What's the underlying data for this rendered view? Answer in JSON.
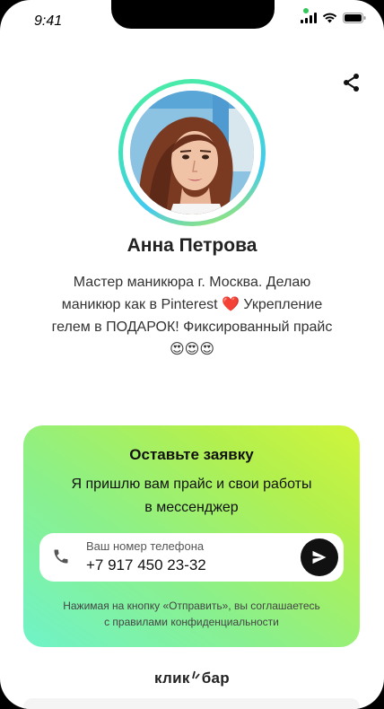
{
  "status_bar": {
    "time": "9:41"
  },
  "profile": {
    "name": "Анна Петрова",
    "bio_line1": "Мастер маникюра г. Москва. Делаю",
    "bio_line2_a": "маникюр как в Pinterest ",
    "bio_heart": "❤️",
    "bio_line2_b": " Укрепление",
    "bio_line3": "гелем в ПОДАРОК! Фиксированный прайс",
    "bio_emojis": "😍😍😍"
  },
  "lead_form": {
    "title": "Оставьте заявку",
    "subtitle_line1": "Я пришлю вам прайс и свои работы",
    "subtitle_line2": "в мессенджер",
    "phone_label": "Ваш номер телефона",
    "phone_value": "+7 917 450 23-32",
    "consent_line1": "Нажимая на кнопку «Отправить», вы соглашаетесь",
    "consent_line2": "с правилами конфиденциальности"
  },
  "footer": {
    "brand_part1": "клик",
    "brand_part2": "бар"
  },
  "colors": {
    "accent_gradient_start": "#6ff3c9",
    "accent_gradient_end": "#d0f53a",
    "send_button": "#111111"
  },
  "icons": {
    "share": "share-icon",
    "phone": "phone-icon",
    "send": "send-icon"
  }
}
